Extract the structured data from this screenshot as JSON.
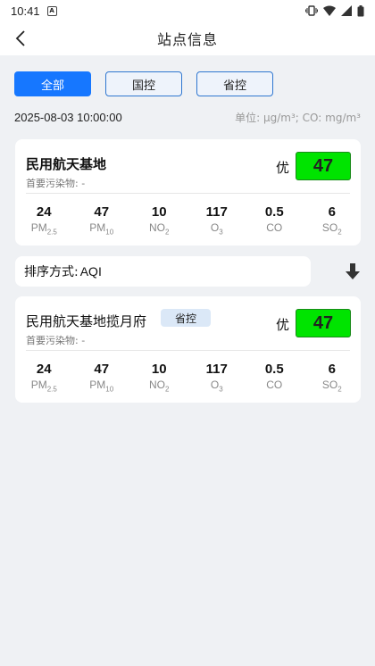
{
  "status_bar": {
    "time": "10:41",
    "notif_letter": "A"
  },
  "header": {
    "title": "站点信息"
  },
  "filters": [
    {
      "label": "全部",
      "active": true
    },
    {
      "label": "国控",
      "active": false
    },
    {
      "label": "省控",
      "active": false
    }
  ],
  "meta": {
    "datetime": "2025-08-03 10:00:00",
    "unit": "单位: μg/m³;  CO: mg/m³"
  },
  "summary_card": {
    "name": "民用航天基地",
    "pollutant_label": "首要污染物: -",
    "level": "优",
    "aqi": "47",
    "aqi_color": "#00e400",
    "metrics": [
      {
        "value": "24",
        "label": "PM",
        "sub": "2.5"
      },
      {
        "value": "47",
        "label": "PM",
        "sub": "10"
      },
      {
        "value": "10",
        "label": "NO",
        "sub": "2"
      },
      {
        "value": "117",
        "label": "O",
        "sub": "3"
      },
      {
        "value": "0.5",
        "label": "CO",
        "sub": ""
      },
      {
        "value": "6",
        "label": "SO",
        "sub": "2"
      }
    ]
  },
  "sort": {
    "label": "排序方式:",
    "value": "AQI",
    "direction_icon": "arrow-down-icon"
  },
  "stations": [
    {
      "name": "民用航天基地揽月府",
      "tag": "省控",
      "pollutant_label": "首要污染物: -",
      "level": "优",
      "aqi": "47",
      "metrics": [
        {
          "value": "24",
          "label": "PM",
          "sub": "2.5"
        },
        {
          "value": "47",
          "label": "PM",
          "sub": "10"
        },
        {
          "value": "10",
          "label": "NO",
          "sub": "2"
        },
        {
          "value": "117",
          "label": "O",
          "sub": "3"
        },
        {
          "value": "0.5",
          "label": "CO",
          "sub": ""
        },
        {
          "value": "6",
          "label": "SO",
          "sub": "2"
        }
      ]
    }
  ]
}
